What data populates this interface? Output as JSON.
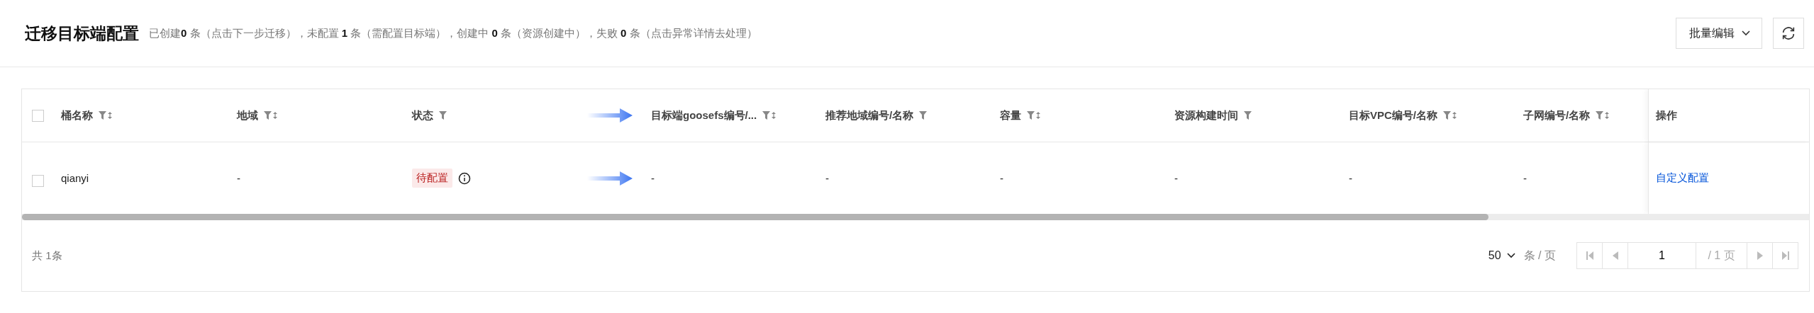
{
  "header": {
    "title": "迁移目标端配置",
    "summary": "已创建**0** 条（点击下一步迁移），未配置 **1** 条（需配置目标端），创建中 **0** 条（资源创建中），失败 **0** 条（点击异常详情去处理）",
    "batch_button": "批量编辑"
  },
  "table": {
    "select_all": {
      "checked": false
    },
    "columns": [
      {
        "kind": "text",
        "label": "桶名称",
        "filter": true,
        "sortable": true
      },
      {
        "kind": "text",
        "label": "地域",
        "filter": true,
        "sortable": true
      },
      {
        "kind": "text",
        "label": "状态",
        "filter": true,
        "sortable": false
      },
      {
        "kind": "arrow"
      },
      {
        "kind": "text",
        "label": "目标端goosefs编号/...",
        "filter": true,
        "sortable": true
      },
      {
        "kind": "text",
        "label": "推荐地域编号/名称",
        "filter": true,
        "sortable": false
      },
      {
        "kind": "text",
        "label": "容量",
        "filter": true,
        "sortable": true
      },
      {
        "kind": "text",
        "label": "资源构建时间",
        "filter": true,
        "sortable": false
      },
      {
        "kind": "text",
        "label": "目标VPC编号/名称",
        "filter": true,
        "sortable": true
      },
      {
        "kind": "text",
        "label": "子网编号/名称",
        "filter": true,
        "sortable": true
      },
      {
        "kind": "text",
        "label": "操作",
        "filter": false,
        "sortable": false
      }
    ],
    "rows": [
      {
        "checked": false,
        "cells": [
          {
            "kind": "text",
            "text": "qianyi"
          },
          {
            "kind": "text",
            "text": "-"
          },
          {
            "kind": "tag",
            "text": "待配置",
            "info": true
          },
          {
            "kind": "arrow"
          },
          {
            "kind": "text",
            "text": "-"
          },
          {
            "kind": "text",
            "text": "-"
          },
          {
            "kind": "text",
            "text": "-"
          },
          {
            "kind": "text",
            "text": "-"
          },
          {
            "kind": "text",
            "text": "-"
          },
          {
            "kind": "text",
            "text": "-"
          },
          {
            "kind": "link",
            "text": "自定义配置"
          }
        ]
      }
    ]
  },
  "footer": {
    "total": "共 1条",
    "page_size": "50",
    "page_size_unit": "条 / 页",
    "page": "1",
    "page_count": "/ 1 页",
    "first_disabled": true,
    "prev_disabled": true,
    "next_disabled": true,
    "last_disabled": true
  }
}
